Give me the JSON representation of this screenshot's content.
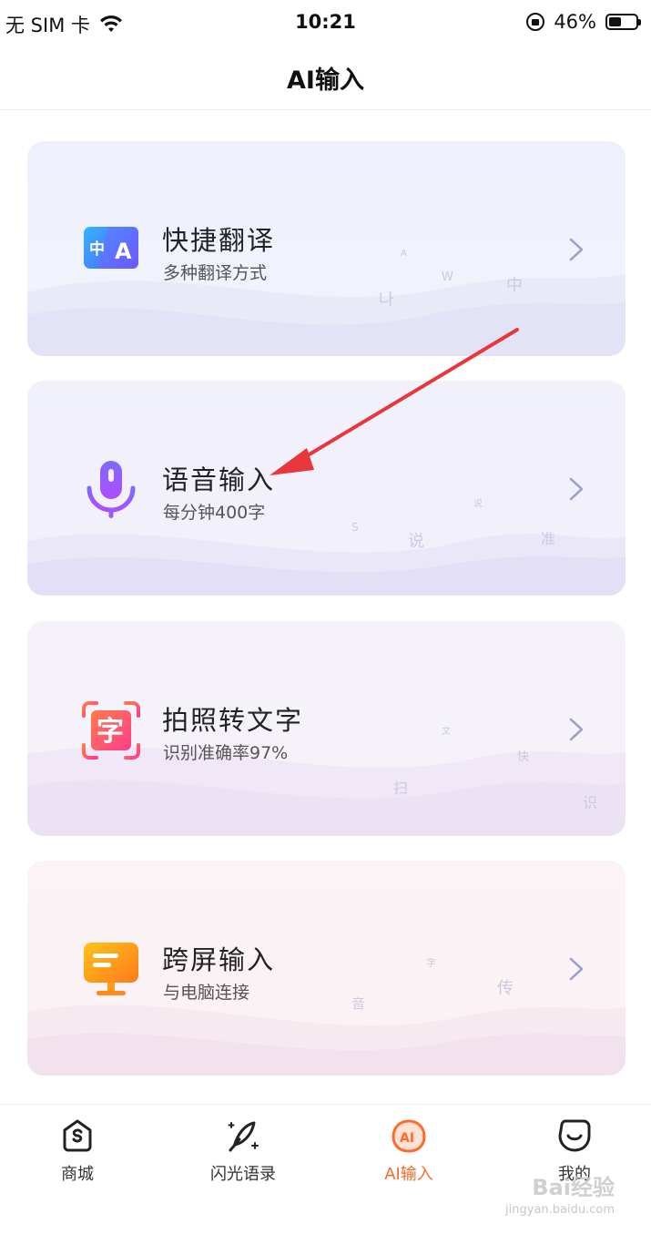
{
  "status_bar": {
    "carrier": "无 SIM 卡",
    "time": "10:21",
    "battery_text": "46%",
    "battery_level": 0.46
  },
  "nav": {
    "title": "AI输入"
  },
  "cards": [
    {
      "title": "快捷翻译",
      "subtitle": "多种翻译方式",
      "icon": "translate-icon",
      "deco": [
        "A",
        "W",
        "中",
        "나"
      ]
    },
    {
      "title": "语音输入",
      "subtitle": "每分钟400字",
      "icon": "microphone-icon",
      "deco": [
        "说",
        "S",
        "说",
        "准"
      ]
    },
    {
      "title": "拍照转文字",
      "subtitle": "识别准确率97%",
      "icon": "scan-text-icon",
      "deco": [
        "文",
        "快",
        "扫",
        "识"
      ]
    },
    {
      "title": "跨屏输入",
      "subtitle": "与电脑连接",
      "icon": "monitor-icon",
      "deco": [
        "字",
        "传",
        "音"
      ]
    }
  ],
  "tabs": [
    {
      "label": "商城",
      "icon": "store-icon"
    },
    {
      "label": "闪光语录",
      "icon": "quill-icon"
    },
    {
      "label": "AI输入",
      "icon": "ai-icon",
      "active": true
    },
    {
      "label": "我的",
      "icon": "profile-icon"
    }
  ],
  "watermark": {
    "text": "Bai经验",
    "sub": "jingyan.baidu.com"
  },
  "colors": {
    "accent": "#ff6a2c",
    "arrow_annotation": "#e8363a"
  }
}
